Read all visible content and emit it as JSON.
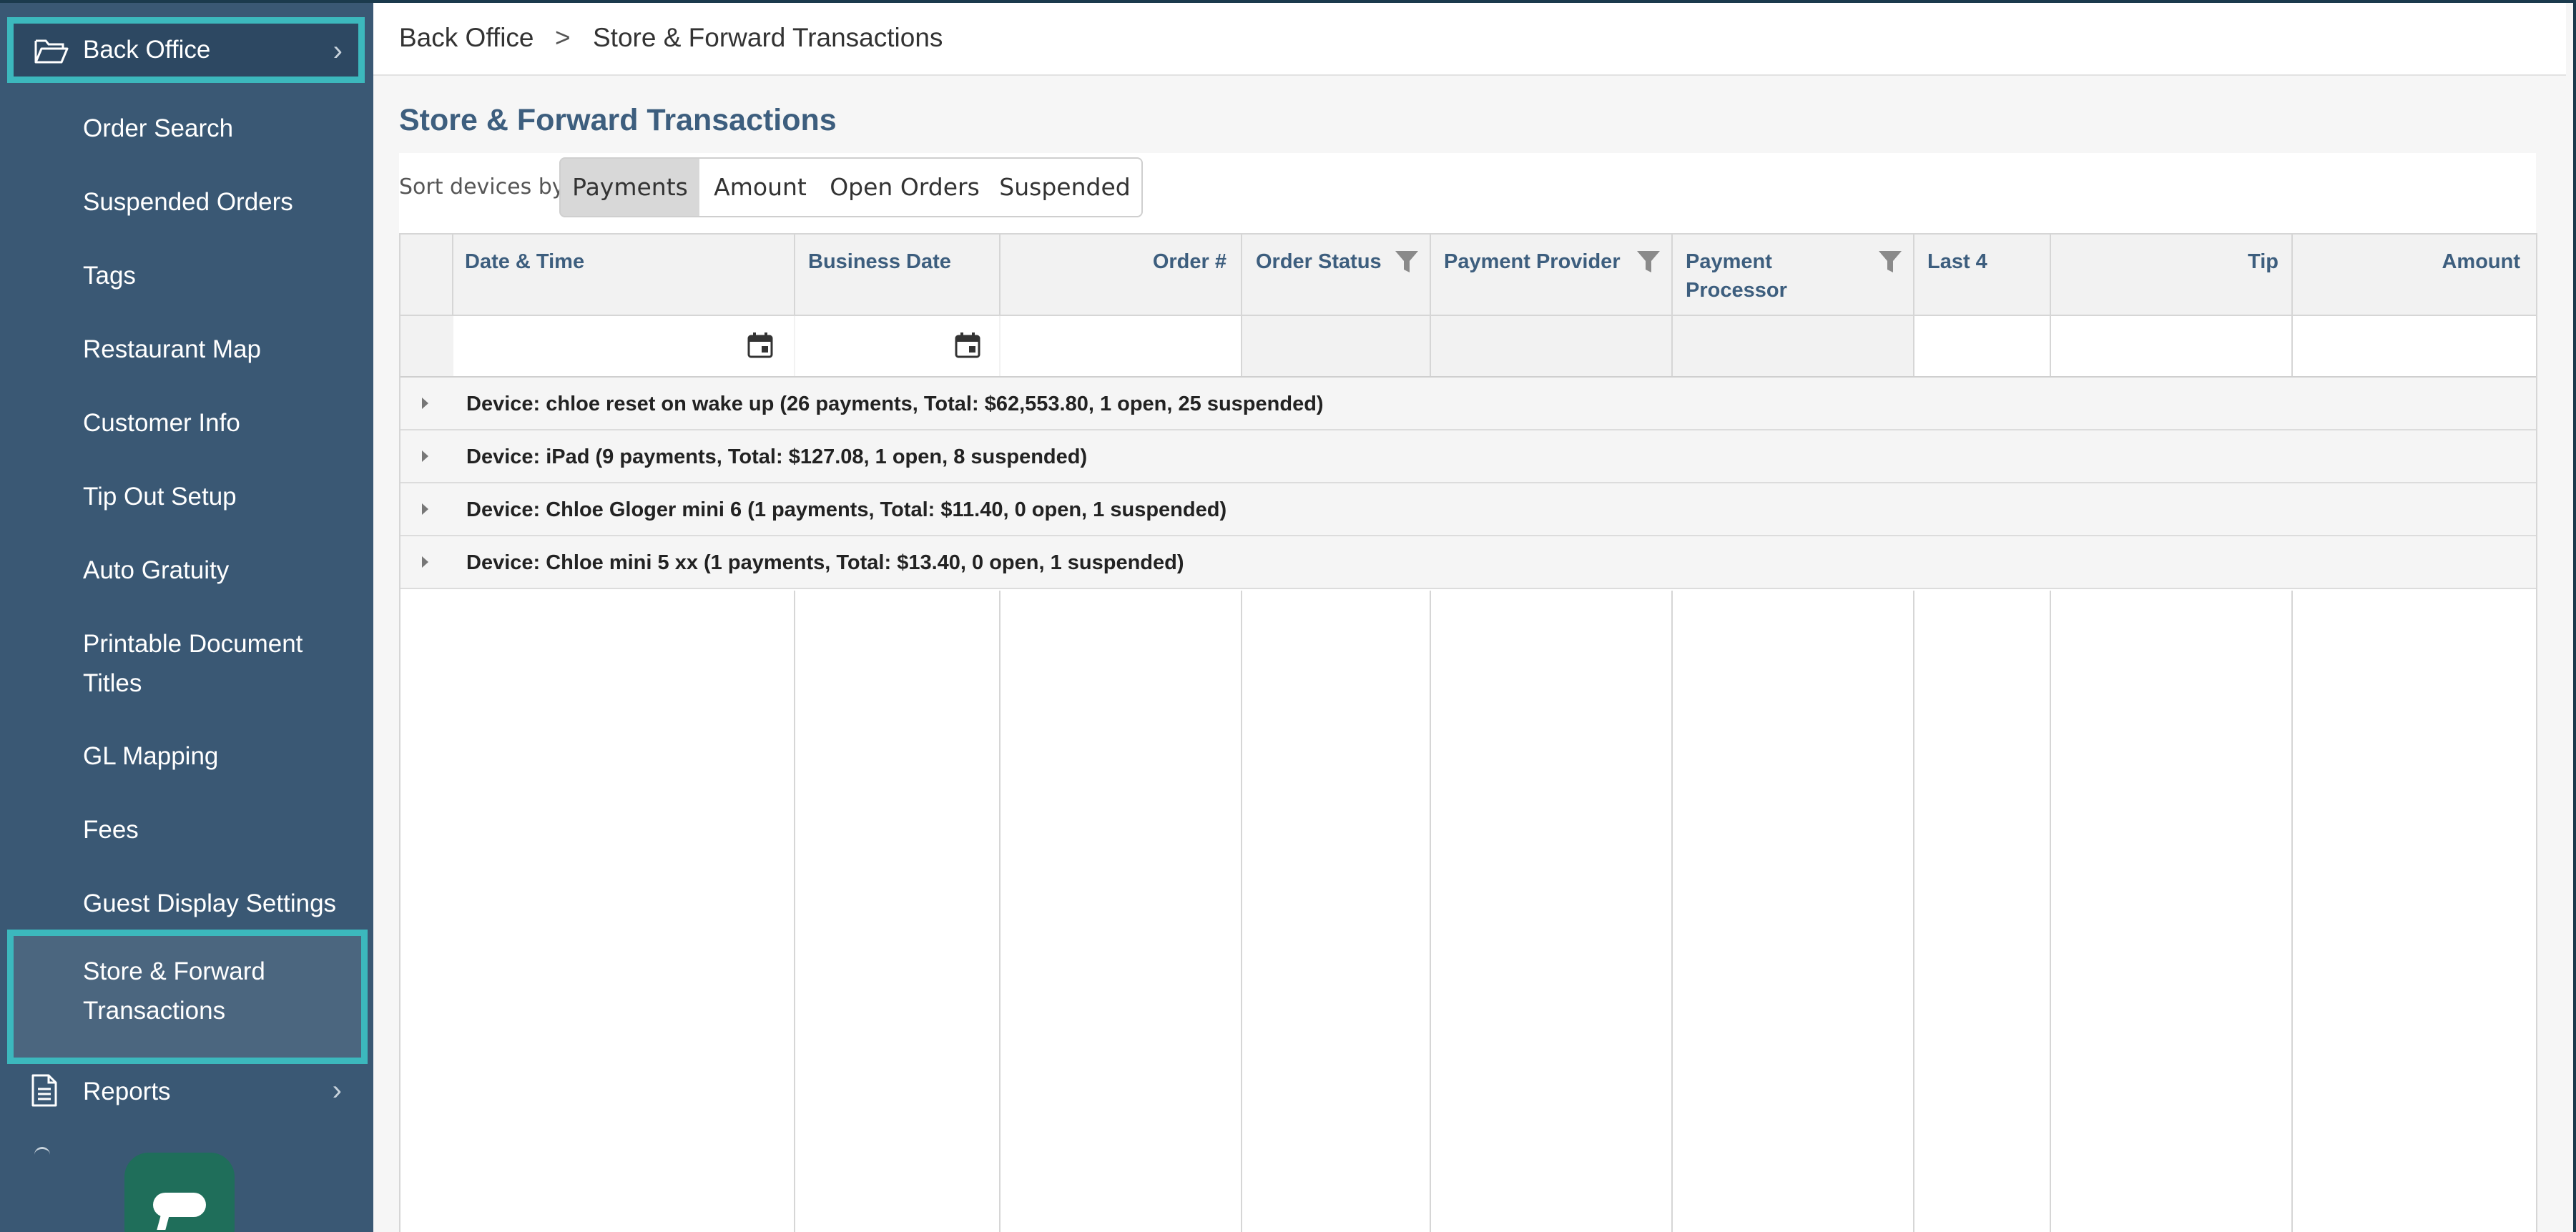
{
  "sidebar": {
    "section_label": "Back Office",
    "items": [
      {
        "label": "Order Search"
      },
      {
        "label": "Suspended Orders"
      },
      {
        "label": "Tags"
      },
      {
        "label": "Restaurant Map"
      },
      {
        "label": "Customer Info"
      },
      {
        "label": "Tip Out Setup"
      },
      {
        "label": "Auto Gratuity"
      },
      {
        "label": "Printable Document Titles"
      },
      {
        "label": "GL Mapping"
      },
      {
        "label": "Fees"
      },
      {
        "label": "Guest Display Settings"
      }
    ],
    "active_label": "Store & Forward Transactions",
    "reports_label": "Reports"
  },
  "breadcrumb": {
    "root": "Back Office",
    "separator": ">",
    "current": "Store & Forward Transactions"
  },
  "page_title": "Store & Forward Transactions",
  "sort": {
    "label": "Sort devices by:",
    "options": [
      {
        "label": "Payments",
        "selected": true
      },
      {
        "label": "Amount",
        "selected": false
      },
      {
        "label": "Open Orders",
        "selected": false
      },
      {
        "label": "Suspended",
        "selected": false
      }
    ]
  },
  "table": {
    "columns": [
      {
        "label": "Date & Time"
      },
      {
        "label": "Business Date"
      },
      {
        "label": "Order #"
      },
      {
        "label": "Order Status"
      },
      {
        "label": "Payment Provider"
      },
      {
        "label": "Payment Processor"
      },
      {
        "label": "Last 4"
      },
      {
        "label": "Tip"
      },
      {
        "label": "Amount"
      }
    ],
    "groups": [
      {
        "label": "Device: chloe reset on wake up (26 payments, Total: $62,553.80, 1 open, 25 suspended)"
      },
      {
        "label": "Device: iPad (9 payments, Total: $127.08, 1 open, 8 suspended)"
      },
      {
        "label": "Device: Chloe Gloger mini 6 (1 payments, Total: $11.40, 0 open, 1 suspended)"
      },
      {
        "label": "Device: Chloe mini 5 xx (1 payments, Total: $13.40, 0 open, 1 suspended)"
      }
    ]
  },
  "colors": {
    "sidebar_bg": "#3a5874",
    "highlight_border": "#3cb8bd",
    "title_color": "#3d5e7e",
    "chat_button": "#1f6e5a"
  }
}
